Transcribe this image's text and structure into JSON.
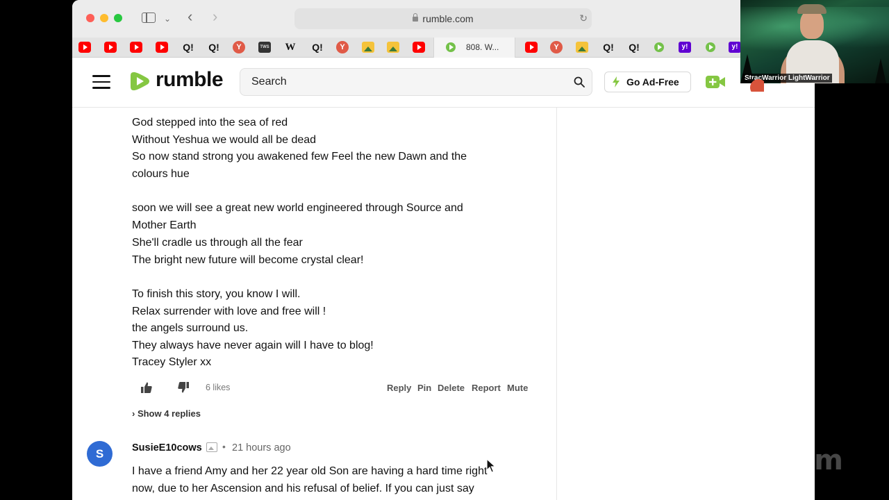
{
  "browser": {
    "url": "rumble.com",
    "active_tab_title": "808. W..."
  },
  "favorites": [
    {
      "kind": "yt",
      "icon": "youtube-icon",
      "label": ""
    },
    {
      "kind": "yt",
      "icon": "youtube-icon",
      "label": ""
    },
    {
      "kind": "yt",
      "icon": "youtube-icon",
      "label": ""
    },
    {
      "kind": "yt",
      "icon": "youtube-icon",
      "label": ""
    },
    {
      "kind": "q",
      "icon": "q-news-icon",
      "label": "Q!"
    },
    {
      "kind": "q",
      "icon": "q-news-icon",
      "label": "Q!"
    },
    {
      "kind": "y",
      "icon": "y-icon",
      "label": "Y"
    },
    {
      "kind": "news",
      "icon": "news-icon",
      "label": "TWS"
    },
    {
      "kind": "w",
      "icon": "wikipedia-icon",
      "label": "W"
    },
    {
      "kind": "q",
      "icon": "q-news-icon",
      "label": "Q!"
    },
    {
      "kind": "y",
      "icon": "y-icon",
      "label": "Y"
    },
    {
      "kind": "img",
      "icon": "image-icon",
      "label": ""
    },
    {
      "kind": "img",
      "icon": "image-icon",
      "label": ""
    },
    {
      "kind": "yt",
      "icon": "youtube-icon",
      "label": ""
    },
    {
      "kind": "rum",
      "icon": "rumble-icon",
      "label": ""
    },
    {
      "kind": "yt",
      "icon": "youtube-icon",
      "label": ""
    },
    {
      "kind": "y",
      "icon": "y-icon",
      "label": "Y"
    },
    {
      "kind": "img",
      "icon": "image-icon",
      "label": ""
    },
    {
      "kind": "q",
      "icon": "q-news-icon",
      "label": "Q!"
    },
    {
      "kind": "q",
      "icon": "q-news-icon",
      "label": "Q!"
    },
    {
      "kind": "rum",
      "icon": "rumble-icon",
      "label": ""
    },
    {
      "kind": "yh",
      "icon": "yahoo-icon",
      "label": "y!"
    },
    {
      "kind": "rum",
      "icon": "rumble-icon",
      "label": ""
    },
    {
      "kind": "yh",
      "icon": "yahoo-icon",
      "label": "y!"
    }
  ],
  "header": {
    "logo_text": "rumble",
    "search_placeholder": "Search",
    "ad_free_label": "Go Ad-Free",
    "brand_color": "#85c742"
  },
  "comment": {
    "lines": [
      "God stepped into the sea of red",
      "Without Yeshua we would all be dead",
      "So now stand strong you awakened few Feel the new Dawn and the",
      "colours hue",
      "",
      "soon we will see a great new world engineered through Source and",
      "Mother Earth",
      "She'll cradle us through all the fear",
      "The bright new future will become crystal clear!",
      "",
      "To finish this story, you know I will.",
      "Relax surrender with love and free will !",
      "the angels surround us.",
      "They always have never again will I have to blog!",
      "Tracey Styler xx"
    ],
    "likes": "6 likes",
    "actions": {
      "reply": "Reply",
      "pin": "Pin",
      "delete": "Delete",
      "report": "Report",
      "mute": "Mute"
    },
    "show_replies": "› Show 4 replies"
  },
  "next_comment": {
    "avatar_letter": "S",
    "avatar_color": "#2f6bd4",
    "user": "SusieE10cows",
    "separator": "•",
    "time": "21 hours ago",
    "lines": [
      "I have a friend Amy and her 22 year old Son are having a hard time right",
      "now, due to her Ascension and his refusal of belief. If you can just say"
    ]
  },
  "zoom": {
    "participant_name": "StracWarrior LightWarrior",
    "watermark": "zoom"
  }
}
